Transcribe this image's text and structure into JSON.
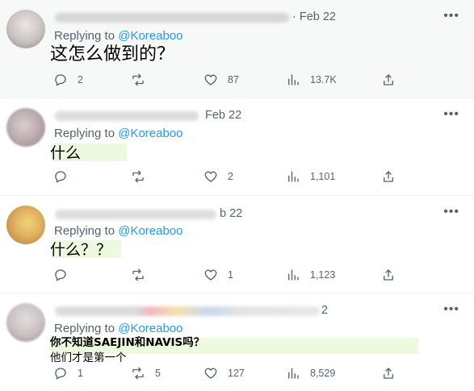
{
  "tweets": [
    {
      "date": "· Feb 22",
      "replying_prefix": "Replying to",
      "replying_handle": "@Koreaboo",
      "text_lines": [
        "这怎么做到的？"
      ],
      "replies": "2",
      "retweets": "",
      "likes": "87",
      "views": "13.7K",
      "avatar_color": "#c9c3c0"
    },
    {
      "date": "Feb 22",
      "replying_prefix": "Replying to",
      "replying_handle": "@Koreaboo",
      "text_lines": [
        "什么"
      ],
      "replies": "",
      "retweets": "",
      "likes": "2",
      "views": "1,101",
      "avatar_color": "#b8a8ac"
    },
    {
      "date": "b 22",
      "replying_prefix": "Replying to",
      "replying_handle": "@Koreaboo",
      "text_lines": [
        "什么？？"
      ],
      "replies": "",
      "retweets": "",
      "likes": "1",
      "views": "1,123",
      "avatar_color": "#e0b060"
    },
    {
      "date": "2",
      "replying_prefix": "Replying to",
      "replying_handle": "@Koreaboo",
      "text_lines": [
        "你不知道SAEJIN和NAVIS吗？",
        "他们才是第一个"
      ],
      "replies": "1",
      "retweets": "5",
      "likes": "127",
      "views": "8,529",
      "avatar_color": "#c8c0c2"
    }
  ],
  "icons": {
    "more": "more-icon",
    "reply": "reply-icon",
    "retweet": "retweet-icon",
    "like": "heart-icon",
    "views": "views-icon",
    "share": "share-icon"
  },
  "colors": {
    "link": "#1d9bf0",
    "muted": "#536471",
    "highlight": "#eefae0",
    "first_bg": "#f7f9f9"
  }
}
